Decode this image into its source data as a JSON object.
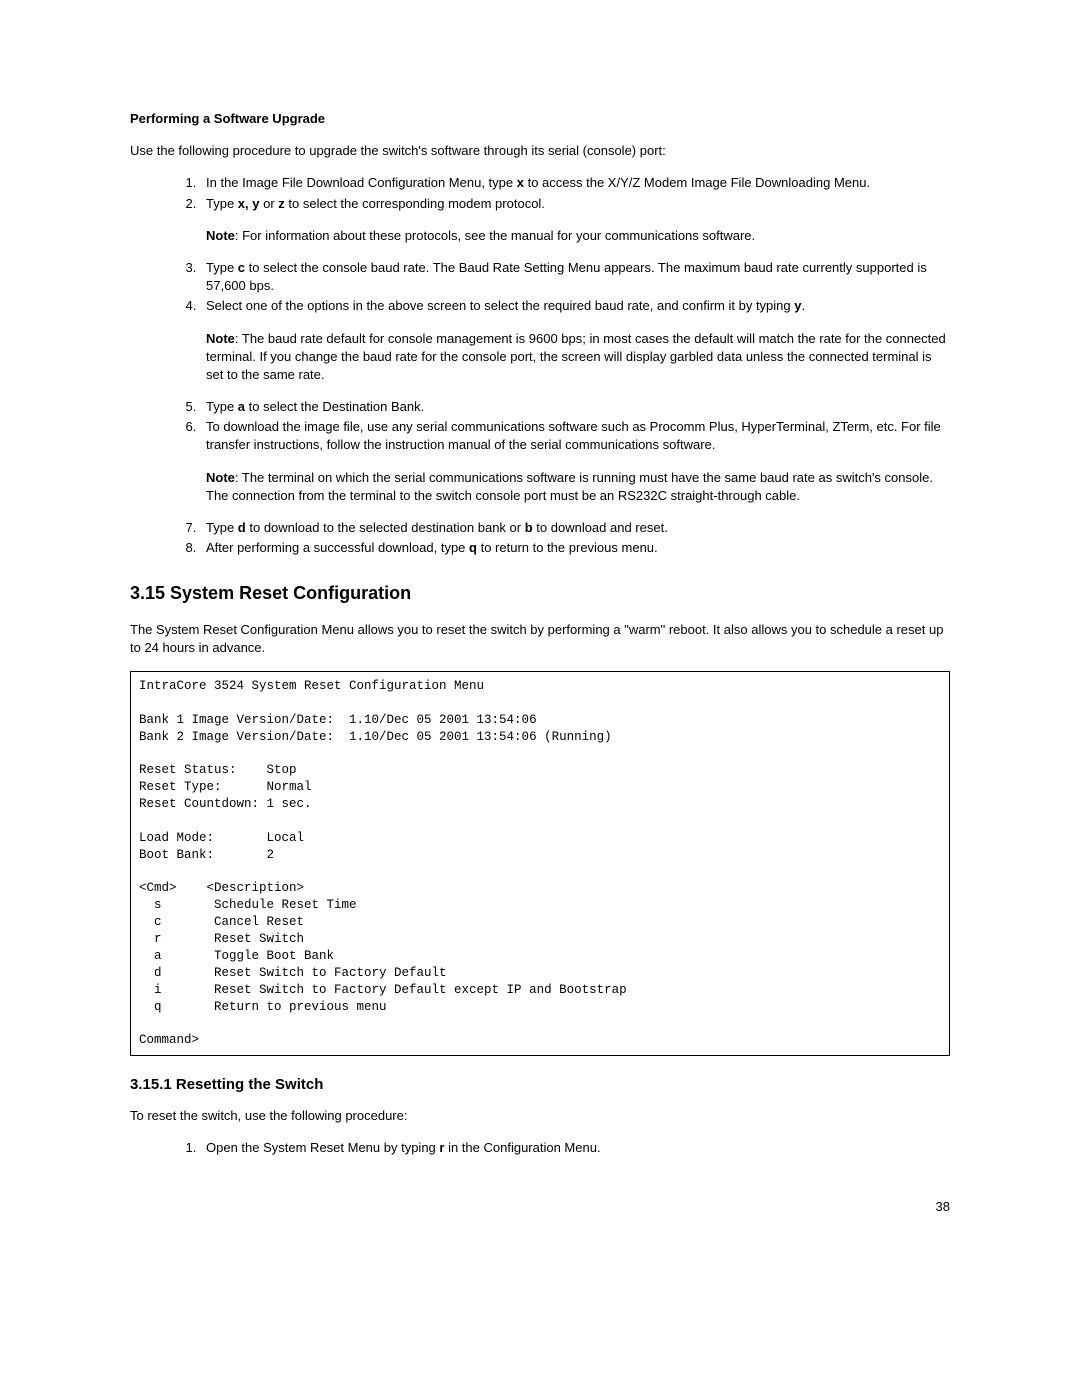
{
  "section1": {
    "title": "Performing a Software Upgrade",
    "intro": "Use the following procedure to upgrade the switch's software through its serial (console) port:",
    "step1_a": "In the Image File Download Configuration Menu, type ",
    "step1_b": " to access the X/Y/Z Modem Image File Downloading Menu.",
    "step2_a": "Type ",
    "step2_b": " or ",
    "step2_c": " to select the corresponding modem protocol.",
    "note2_a": "Note",
    "note2_b": ": For information about these protocols, see the manual for your communications software.",
    "step3_a": "Type ",
    "step3_b": " to select the console baud rate. The Baud Rate Setting Menu appears. The maximum baud rate currently supported is 57,600 bps.",
    "step4_a": "Select one of the options in the above screen to select the required baud rate, and confirm it by typing ",
    "note4_a": "Note",
    "note4_b": ": The baud rate default for console management is 9600 bps; in most cases the default will match the rate for the connected terminal. If you change the baud rate for the console port, the screen will display garbled data unless the connected terminal is set to the same rate.",
    "step5_a": "Type ",
    "step5_b": " to select the Destination Bank.",
    "step6": "To download the image file, use any serial communications software such as Procomm Plus, HyperTerminal, ZTerm, etc. For file transfer instructions, follow the instruction manual of the serial communications software.",
    "note6_a": "Note",
    "note6_b": ": The terminal on which the serial communications software is running must have the same baud rate as switch's console. The connection from the terminal to the switch console port must be an RS232C straight-through cable.",
    "step7_a": "Type ",
    "step7_b": " to download to the selected destination bank or ",
    "step7_c": " to download and reset.",
    "step8_a": "After performing a successful download, type ",
    "step8_b": " to return to the previous menu.",
    "k_x": "x",
    "k_xy": "x, y",
    "k_z": "z",
    "k_c": "c",
    "k_y": "y",
    "k_a": "a",
    "k_d": "d",
    "k_b": "b",
    "k_q": "q"
  },
  "section2": {
    "heading": "3.15 System Reset Configuration",
    "para": "The System Reset Configuration Menu allows you to reset the switch by performing a \"warm\" reboot. It also allows you to schedule a reset up to 24 hours in advance.",
    "terminal": "IntraCore 3524 System Reset Configuration Menu\n\nBank 1 Image Version/Date:  1.10/Dec 05 2001 13:54:06\nBank 2 Image Version/Date:  1.10/Dec 05 2001 13:54:06 (Running)\n\nReset Status:    Stop\nReset Type:      Normal\nReset Countdown: 1 sec.\n\nLoad Mode:       Local\nBoot Bank:       2\n\n<Cmd>    <Description>\n  s       Schedule Reset Time\n  c       Cancel Reset\n  r       Reset Switch\n  a       Toggle Boot Bank\n  d       Reset Switch to Factory Default\n  i       Reset Switch to Factory Default except IP and Bootstrap\n  q       Return to previous menu\n\nCommand>"
  },
  "section3": {
    "heading": "3.15.1 Resetting the Switch",
    "para": "To reset the switch, use the following procedure:",
    "step1_a": "Open the System Reset Menu by typing ",
    "step1_b": " in the Configuration Menu.",
    "k_r": "r"
  },
  "page_number": "38"
}
